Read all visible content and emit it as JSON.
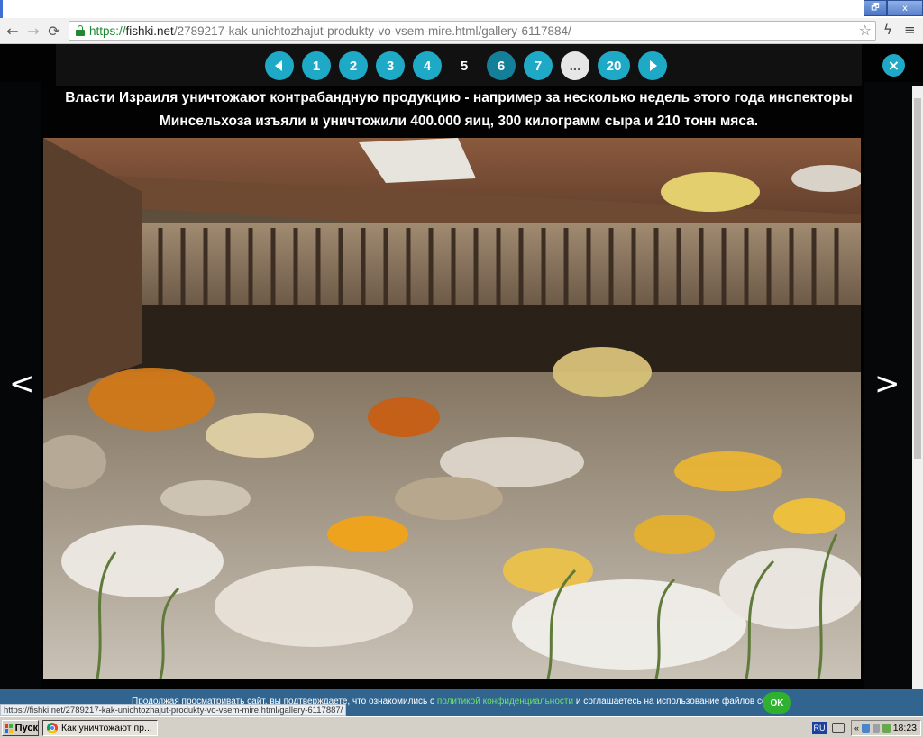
{
  "window": {
    "minimize_label": "🗗",
    "close_label": "x"
  },
  "toolbar": {
    "back_icon": "←",
    "forward_icon": "→",
    "reload_icon": "⟳",
    "url_scheme": "https://",
    "url_host": "fishki.net",
    "url_path": "/2789217-kak-unichtozhajut-produkty-vo-vsem-mire.html/gallery-6117884/",
    "star_icon": "☆",
    "extension_icon": "ϟ",
    "menu_icon": "≡"
  },
  "gallery": {
    "pager": {
      "prev_label": "",
      "pages": [
        "1",
        "2",
        "3",
        "4",
        "5",
        "6",
        "7"
      ],
      "current": "5",
      "more_label": "...",
      "last": "20",
      "next_label": ""
    },
    "close_label": "×",
    "caption": "Власти Израиля уничтожают контрабандную продукцию - например за несколько недель этого года инспекторы Минсельхоза изъяли и уничтожили 400.000 яиц, 300 килограмм сыра и 210 тонн мяса.",
    "prev_arrow": "<",
    "next_arrow": ">"
  },
  "cookie_bar": {
    "text_before": "Продолжая просматривать сайт, вы подтверждаете, что ознакомились с ",
    "link": "политикой конфиденциальности",
    "text_after": " и соглашаетесь на использование файлов cookie.",
    "ok_label": "OK"
  },
  "status_bar": {
    "url": "https://fishki.net/2789217-kak-unichtozhajut-produkty-vo-vsem-mire.html/gallery-6117887/"
  },
  "taskbar": {
    "start_label": "Пуск",
    "task_label": "Как уничтожают пр...",
    "lang": "RU",
    "clock": "18:23"
  }
}
